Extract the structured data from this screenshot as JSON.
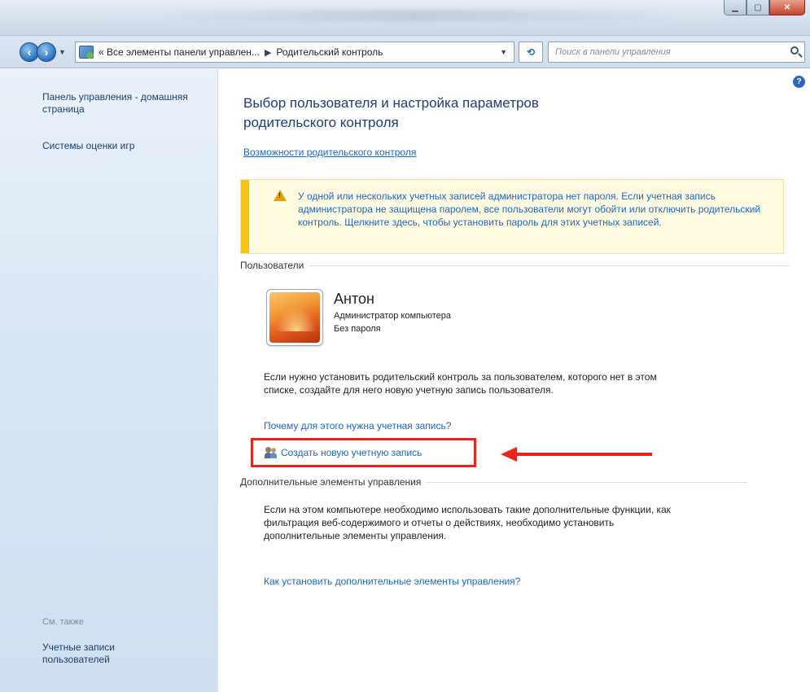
{
  "address": {
    "segments": [
      "« Все элементы панели управлен...",
      "Родительский контроль"
    ],
    "separator": "▶"
  },
  "search": {
    "placeholder": "Поиск в панели управления"
  },
  "sidebar": {
    "items": [
      {
        "label": "Панель управления - домашняя страница"
      },
      {
        "label": "Системы оценки игр"
      }
    ],
    "see_also": {
      "title": "См. также",
      "links": [
        {
          "label": "Учетные записи пользователей"
        }
      ]
    }
  },
  "main": {
    "title": "Выбор пользователя и настройка параметров родительского контроля",
    "features_link": "Возможности родительского контроля",
    "warning": "У одной или нескольких учетных записей администратора нет пароля. Если учетная запись администратора не защищена паролем, все пользователи могут обойти или отключить родительский контроль. Щелкните здесь, чтобы установить пароль для этих учетных записей.",
    "users_section": "Пользователи",
    "user": {
      "name": "Антон",
      "role": "Администратор компьютера",
      "password_status": "Без пароля"
    },
    "info_text": "Если нужно установить родительский контроль за пользователем, которого нет в этом списке, создайте для него новую учетную запись пользователя.",
    "why_link": "Почему для этого нужна учетная запись?",
    "create_link": "Создать новую учетную запись",
    "extra_section": "Дополнительные элементы управления",
    "extra_text": "Если на этом компьютере необходимо использовать такие дополнительные функции, как фильтрация веб-содержимого и отчеты о действиях, необходимо установить дополнительные элементы управления.",
    "extra_link": "Как установить дополнительные элементы управления?"
  },
  "colors": {
    "link": "#1b66c9",
    "title": "#1e3c78",
    "warning_bar": "#f5c316",
    "highlight": "#e8241c"
  }
}
